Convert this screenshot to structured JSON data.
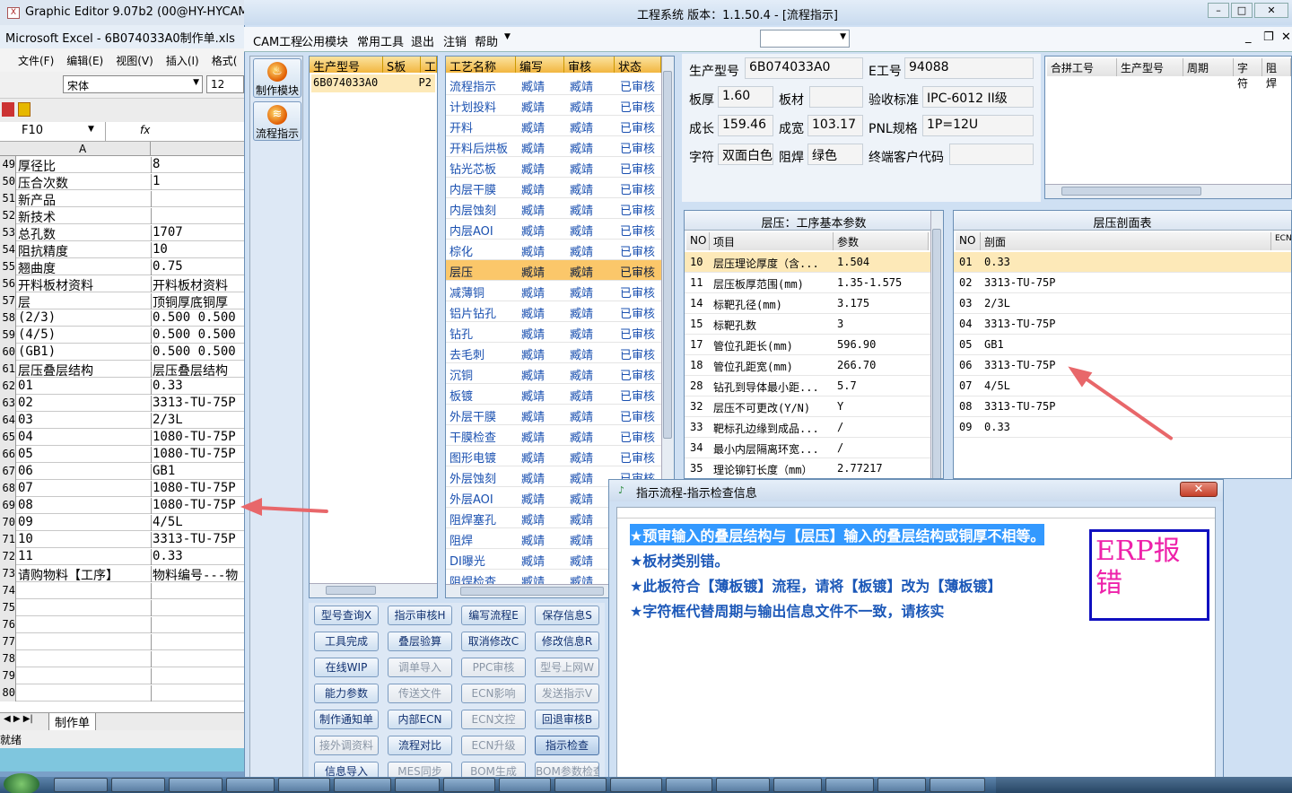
{
  "excel": {
    "graphic_title": "Graphic Editor 9.07b2 (00@HY-HYCAM-P",
    "title": "Microsoft Excel - 6B074033A0制作单.xls",
    "menu": [
      "文件(F)",
      "编辑(E)",
      "视图(V)",
      "插入(I)",
      "格式("
    ],
    "font_name": "宋体",
    "font_size": "12",
    "namebox": "F10",
    "fx": "fx",
    "col_a": "A",
    "rows": [
      {
        "n": "49",
        "a": "厚径比",
        "b": "8"
      },
      {
        "n": "50",
        "a": "压合次数",
        "b": "1"
      },
      {
        "n": "51",
        "a": "新产品",
        "b": ""
      },
      {
        "n": "52",
        "a": "新技术",
        "b": ""
      },
      {
        "n": "53",
        "a": "总孔数",
        "b": "1707"
      },
      {
        "n": "54",
        "a": "阻抗精度",
        "b": "10"
      },
      {
        "n": "55",
        "a": "翘曲度",
        "b": "0.75"
      },
      {
        "n": "56",
        "a": "开料板材资料",
        "b": "开料板材资料"
      },
      {
        "n": "57",
        "a": "层",
        "b": "顶铜厚底铜厚"
      },
      {
        "n": "58",
        "a": "(2/3)",
        "b": "0.500  0.500"
      },
      {
        "n": "59",
        "a": "(4/5)",
        "b": "0.500  0.500"
      },
      {
        "n": "60",
        "a": "(GB1)",
        "b": "0.500  0.500"
      },
      {
        "n": "61",
        "a": "层压叠层结构",
        "b": "层压叠层结构"
      },
      {
        "n": "62",
        "a": "01",
        "b": "0.33"
      },
      {
        "n": "63",
        "a": "02",
        "b": "3313-TU-75P"
      },
      {
        "n": "64",
        "a": "03",
        "b": "2/3L"
      },
      {
        "n": "65",
        "a": "04",
        "b": "1080-TU-75P"
      },
      {
        "n": "66",
        "a": "05",
        "b": "1080-TU-75P"
      },
      {
        "n": "67",
        "a": "06",
        "b": "GB1"
      },
      {
        "n": "68",
        "a": "07",
        "b": "1080-TU-75P"
      },
      {
        "n": "69",
        "a": "08",
        "b": "1080-TU-75P"
      },
      {
        "n": "70",
        "a": "09",
        "b": "4/5L"
      },
      {
        "n": "71",
        "a": "10",
        "b": "3313-TU-75P"
      },
      {
        "n": "72",
        "a": "11",
        "b": "0.33"
      },
      {
        "n": "73",
        "a": "请购物料【工序】",
        "b": "物料编号---物"
      },
      {
        "n": "74",
        "a": "",
        "b": ""
      },
      {
        "n": "75",
        "a": "",
        "b": ""
      },
      {
        "n": "76",
        "a": "",
        "b": ""
      },
      {
        "n": "77",
        "a": "",
        "b": ""
      },
      {
        "n": "78",
        "a": "",
        "b": ""
      },
      {
        "n": "79",
        "a": "",
        "b": ""
      },
      {
        "n": "80",
        "a": "",
        "b": ""
      }
    ],
    "sheet_tab": "制作单",
    "status": "就绪"
  },
  "main": {
    "title": "工程系统    版本：1.1.50.4 - [流程指示]",
    "menu": [
      "CAM工程",
      "公用模块",
      "常用工具",
      "退出",
      "注销",
      "帮助"
    ],
    "left_buttons": [
      "制作模块",
      "流程指示"
    ],
    "product_headers": [
      "生产型号",
      "S板",
      "工"
    ],
    "product_row": {
      "model": "6B074033A0",
      "extra": "P2"
    },
    "process_headers": [
      "工艺名称",
      "编写",
      "审核",
      "状态"
    ],
    "processes": [
      {
        "name": "流程指示",
        "w": "臧靖",
        "r": "臧靖",
        "s": "已审核"
      },
      {
        "name": "计划投料",
        "w": "臧靖",
        "r": "臧靖",
        "s": "已审核"
      },
      {
        "name": "开料",
        "w": "臧靖",
        "r": "臧靖",
        "s": "已审核"
      },
      {
        "name": "开料后烘板",
        "w": "臧靖",
        "r": "臧靖",
        "s": "已审核"
      },
      {
        "name": "钻光芯板",
        "w": "臧靖",
        "r": "臧靖",
        "s": "已审核"
      },
      {
        "name": "内层干膜",
        "w": "臧靖",
        "r": "臧靖",
        "s": "已审核"
      },
      {
        "name": "内层蚀刻",
        "w": "臧靖",
        "r": "臧靖",
        "s": "已审核"
      },
      {
        "name": "内层AOI",
        "w": "臧靖",
        "r": "臧靖",
        "s": "已审核"
      },
      {
        "name": "棕化",
        "w": "臧靖",
        "r": "臧靖",
        "s": "已审核"
      },
      {
        "name": "层压",
        "w": "臧靖",
        "r": "臧靖",
        "s": "已审核"
      },
      {
        "name": "减薄铜",
        "w": "臧靖",
        "r": "臧靖",
        "s": "已审核"
      },
      {
        "name": "铝片钻孔",
        "w": "臧靖",
        "r": "臧靖",
        "s": "已审核"
      },
      {
        "name": "钻孔",
        "w": "臧靖",
        "r": "臧靖",
        "s": "已审核"
      },
      {
        "name": "去毛刺",
        "w": "臧靖",
        "r": "臧靖",
        "s": "已审核"
      },
      {
        "name": "沉铜",
        "w": "臧靖",
        "r": "臧靖",
        "s": "已审核"
      },
      {
        "name": "板镀",
        "w": "臧靖",
        "r": "臧靖",
        "s": "已审核"
      },
      {
        "name": "外层干膜",
        "w": "臧靖",
        "r": "臧靖",
        "s": "已审核"
      },
      {
        "name": "干膜检查",
        "w": "臧靖",
        "r": "臧靖",
        "s": "已审核"
      },
      {
        "name": "图形电镀",
        "w": "臧靖",
        "r": "臧靖",
        "s": "已审核"
      },
      {
        "name": "外层蚀刻",
        "w": "臧靖",
        "r": "臧靖",
        "s": "已审核"
      },
      {
        "name": "外层AOI",
        "w": "臧靖",
        "r": "臧靖",
        "s": "已审核"
      },
      {
        "name": "阻焊塞孔",
        "w": "臧靖",
        "r": "臧靖",
        "s": "已审核"
      },
      {
        "name": "阻焊",
        "w": "臧靖",
        "r": "臧靖",
        "s": "已审核"
      },
      {
        "name": "DI曝光",
        "w": "臧靖",
        "r": "臧靖",
        "s": "已审核"
      },
      {
        "name": "阻焊检查",
        "w": "臧靖",
        "r": "臧靖",
        "s": "已审核"
      }
    ],
    "selected_process_index": 9,
    "buttons": [
      [
        "型号查询X",
        "指示审核H",
        "编写流程E",
        "保存信息S"
      ],
      [
        "工具完成",
        "叠层验算",
        "取消修改C",
        "修改信息R"
      ],
      [
        "在线WIP",
        "调单导入",
        "PPC审核",
        "型号上网W"
      ],
      [
        "能力参数",
        "传送文件",
        "ECN影响",
        "发送指示V"
      ],
      [
        "制作通知单",
        "内部ECN",
        "ECN文控",
        "回退审核B"
      ],
      [
        "接外调资料",
        "流程对比",
        "ECN升级",
        "指示检查"
      ],
      [
        "信息导入",
        "MES同步",
        "BOM生成",
        "BOM参数检查"
      ]
    ],
    "disabled_buttons": [
      "调单导入",
      "PPC审核",
      "型号上网W",
      "传送文件",
      "ECN影响",
      "发送指示V",
      "ECN文控",
      "接外调资料",
      "ECN升级",
      "MES同步",
      "BOM生成",
      "BOM参数检查"
    ],
    "info": {
      "model_label": "生产型号",
      "model": "6B074033A0",
      "e_label": "E工号",
      "e": "94088",
      "thick_label": "板厚",
      "thick": "1.60",
      "material_label": "板材",
      "material": "",
      "std_label": "验收标准",
      "std": "IPC-6012 II级",
      "len_label": "成长",
      "len": "159.46",
      "wid_label": "成宽",
      "wid": "103.17",
      "pnl_label": "PNL规格",
      "pnl": "1P=12U",
      "char_label": "字符",
      "char": "双面白色",
      "mask_label": "阻焊",
      "mask": "绿色",
      "cust_label": "终端客户代码",
      "cust": ""
    },
    "merge_headers": [
      "合拼工号",
      "生产型号",
      "周期",
      "字符",
      "阻焊"
    ],
    "params_title": "层压：工序基本参数",
    "params_headers": [
      "NO",
      "项目",
      "参数"
    ],
    "params": [
      {
        "no": "10",
        "item": "层压理论厚度（含...",
        "val": "1.504"
      },
      {
        "no": "11",
        "item": "层压板厚范围(mm)",
        "val": "1.35-1.575"
      },
      {
        "no": "14",
        "item": "标靶孔径(mm)",
        "val": "3.175"
      },
      {
        "no": "15",
        "item": "标靶孔数",
        "val": "3"
      },
      {
        "no": "17",
        "item": "管位孔距长(mm)",
        "val": "596.90"
      },
      {
        "no": "18",
        "item": "管位孔距宽(mm)",
        "val": "266.70"
      },
      {
        "no": "28",
        "item": "钻孔到导体最小距...",
        "val": "5.7"
      },
      {
        "no": "32",
        "item": "层压不可更改(Y/N)",
        "val": "Y"
      },
      {
        "no": "33",
        "item": "靶标孔边缘到成品...",
        "val": "/"
      },
      {
        "no": "34",
        "item": "最小内层隔离环宽...",
        "val": "/"
      },
      {
        "no": "35",
        "item": "理论铆钉长度（mm）",
        "val": "2.77217"
      }
    ],
    "profile_title": "层压剖面表",
    "profile_headers": [
      "NO",
      "剖面",
      "ECN"
    ],
    "profile": [
      {
        "no": "01",
        "val": "0.33"
      },
      {
        "no": "02",
        "val": "3313-TU-75P"
      },
      {
        "no": "03",
        "val": "2/3L"
      },
      {
        "no": "04",
        "val": "3313-TU-75P"
      },
      {
        "no": "05",
        "val": "GB1"
      },
      {
        "no": "06",
        "val": "3313-TU-75P"
      },
      {
        "no": "07",
        "val": "4/5L"
      },
      {
        "no": "08",
        "val": "3313-TU-75P"
      },
      {
        "no": "09",
        "val": "0.33"
      }
    ]
  },
  "dialog": {
    "title": "指示流程-指示检查信息",
    "messages": [
      "★预审输入的叠层结构与【层压】输入的叠层结构或铜厚不相等。",
      "★板材类别错。",
      "★此板符合【薄板镀】流程，请将【板镀】改为【薄板镀】",
      "★字符框代替周期与输出信息文件不一致，请核实"
    ],
    "annotation": "ERP报错"
  },
  "colors": {
    "accent": "#fbc76a",
    "arrow": "#e8676a",
    "erp_box": "#1010c0",
    "erp_text": "#ee22aa"
  }
}
